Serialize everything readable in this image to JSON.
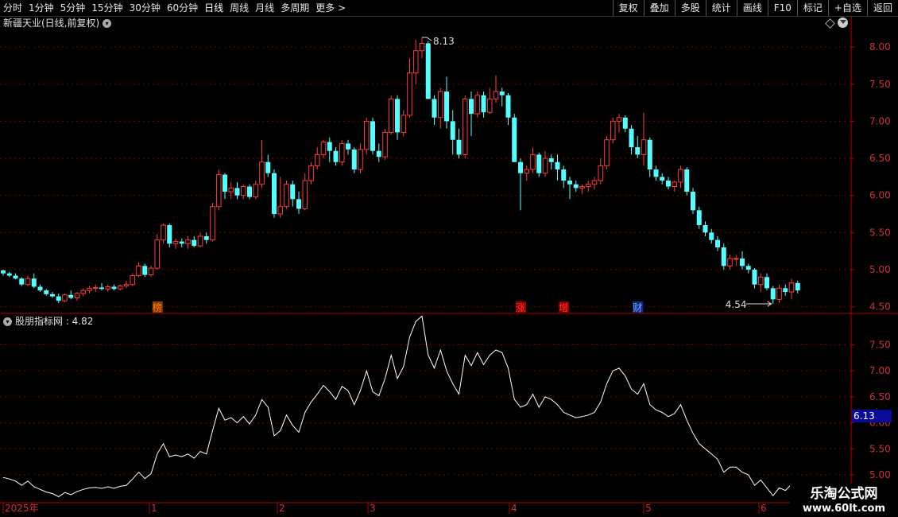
{
  "toolbar": {
    "periods": [
      "分时",
      "1分钟",
      "5分钟",
      "15分钟",
      "30分钟",
      "60分钟",
      "日线",
      "周线",
      "月线",
      "多周期",
      "更多 >"
    ],
    "active": "日线",
    "buttons": [
      "复权",
      "叠加",
      "多股",
      "统计",
      "画线",
      "F10",
      "标记",
      "+自选",
      "返回"
    ]
  },
  "title": "新疆天业(日线,前复权)",
  "indicator": {
    "name": "股朋指标网",
    "value": "4.82",
    "label": "股朋指标网 : 4.82"
  },
  "markers": [
    "榜",
    "涨",
    "增",
    "财"
  ],
  "annotations": {
    "high": "8.13",
    "low": "4.54"
  },
  "badge": "6.13",
  "xlabels": [
    "2025年",
    "1",
    "2",
    "3",
    "4",
    "5",
    "6"
  ],
  "watermark": {
    "top": "乐淘公式网",
    "bottom": "www.60lt.com"
  },
  "colors": {
    "up": "#ff3a3a",
    "down": "#54ffff",
    "grid": "#7a0000",
    "axis": "#b40000",
    "line": "#ffffff"
  },
  "chart_data": [
    {
      "type": "candlestick",
      "title": "新疆天业(日线,前复权)",
      "ylim": [
        4.4,
        8.25
      ],
      "yticks": [
        4.5,
        5.0,
        5.5,
        6.0,
        6.5,
        7.0,
        7.5,
        8.0
      ],
      "candles": [
        [
          4.99,
          5.0,
          4.92,
          4.95
        ],
        [
          4.95,
          4.97,
          4.9,
          4.92
        ],
        [
          4.92,
          4.95,
          4.87,
          4.88
        ],
        [
          4.88,
          4.9,
          4.78,
          4.8
        ],
        [
          4.8,
          4.92,
          4.78,
          4.88
        ],
        [
          4.88,
          4.95,
          4.75,
          4.77
        ],
        [
          4.77,
          4.8,
          4.7,
          4.72
        ],
        [
          4.72,
          4.74,
          4.65,
          4.67
        ],
        [
          4.67,
          4.7,
          4.62,
          4.64
        ],
        [
          4.64,
          4.68,
          4.55,
          4.58
        ],
        [
          4.58,
          4.68,
          4.56,
          4.66
        ],
        [
          4.66,
          4.72,
          4.6,
          4.62
        ],
        [
          4.62,
          4.7,
          4.58,
          4.68
        ],
        [
          4.68,
          4.75,
          4.64,
          4.72
        ],
        [
          4.72,
          4.78,
          4.68,
          4.75
        ],
        [
          4.75,
          4.8,
          4.7,
          4.76
        ],
        [
          4.76,
          4.82,
          4.72,
          4.74
        ],
        [
          4.74,
          4.8,
          4.7,
          4.77
        ],
        [
          4.77,
          4.8,
          4.72,
          4.74
        ],
        [
          4.74,
          4.8,
          4.72,
          4.78
        ],
        [
          4.78,
          4.85,
          4.75,
          4.8
        ],
        [
          4.8,
          4.95,
          4.78,
          4.92
        ],
        [
          4.92,
          5.1,
          4.9,
          5.05
        ],
        [
          5.05,
          5.08,
          4.9,
          4.93
        ],
        [
          4.93,
          5.05,
          4.9,
          5.02
        ],
        [
          5.02,
          5.48,
          5.0,
          5.4
        ],
        [
          5.4,
          5.62,
          5.35,
          5.6
        ],
        [
          5.6,
          5.62,
          5.3,
          5.35
        ],
        [
          5.35,
          5.42,
          5.28,
          5.38
        ],
        [
          5.38,
          5.42,
          5.3,
          5.35
        ],
        [
          5.35,
          5.45,
          5.28,
          5.4
        ],
        [
          5.4,
          5.45,
          5.3,
          5.32
        ],
        [
          5.32,
          5.5,
          5.3,
          5.45
        ],
        [
          5.45,
          5.5,
          5.35,
          5.4
        ],
        [
          5.4,
          5.9,
          5.38,
          5.85
        ],
        [
          5.85,
          6.35,
          5.8,
          6.28
        ],
        [
          6.28,
          6.3,
          5.95,
          6.05
        ],
        [
          6.05,
          6.18,
          5.95,
          6.1
        ],
        [
          6.1,
          6.18,
          5.95,
          6.0
        ],
        [
          6.0,
          6.15,
          5.95,
          6.12
        ],
        [
          6.12,
          6.15,
          5.95,
          5.98
        ],
        [
          5.98,
          6.2,
          5.95,
          6.15
        ],
        [
          6.15,
          6.75,
          6.1,
          6.45
        ],
        [
          6.45,
          6.55,
          6.25,
          6.3
        ],
        [
          6.3,
          6.35,
          5.7,
          5.75
        ],
        [
          5.75,
          6.25,
          5.7,
          5.85
        ],
        [
          5.85,
          6.2,
          5.82,
          6.15
        ],
        [
          6.15,
          6.2,
          5.85,
          5.95
        ],
        [
          5.95,
          6.05,
          5.75,
          5.82
        ],
        [
          5.82,
          6.3,
          5.8,
          6.2
        ],
        [
          6.2,
          6.45,
          6.15,
          6.4
        ],
        [
          6.4,
          6.65,
          6.35,
          6.55
        ],
        [
          6.55,
          6.75,
          6.5,
          6.72
        ],
        [
          6.72,
          6.78,
          6.45,
          6.6
        ],
        [
          6.6,
          6.65,
          6.4,
          6.45
        ],
        [
          6.45,
          6.75,
          6.4,
          6.7
        ],
        [
          6.7,
          6.75,
          6.55,
          6.62
        ],
        [
          6.62,
          6.65,
          6.3,
          6.35
        ],
        [
          6.35,
          6.7,
          6.3,
          6.62
        ],
        [
          6.62,
          7.05,
          6.55,
          7.0
        ],
        [
          7.0,
          7.05,
          6.55,
          6.6
        ],
        [
          6.6,
          6.7,
          6.45,
          6.52
        ],
        [
          6.52,
          6.9,
          6.48,
          6.85
        ],
        [
          6.85,
          7.35,
          6.82,
          7.3
        ],
        [
          7.3,
          7.35,
          6.75,
          6.85
        ],
        [
          6.85,
          7.15,
          6.8,
          7.08
        ],
        [
          7.08,
          7.85,
          7.05,
          7.65
        ],
        [
          7.65,
          8.1,
          7.5,
          7.95
        ],
        [
          7.95,
          8.13,
          7.85,
          8.05
        ],
        [
          8.05,
          8.08,
          7.3,
          7.3
        ],
        [
          7.3,
          7.35,
          6.95,
          7.05
        ],
        [
          7.05,
          7.45,
          6.9,
          7.4
        ],
        [
          7.4,
          7.6,
          6.9,
          7.0
        ],
        [
          7.0,
          7.15,
          6.55,
          6.75
        ],
        [
          6.75,
          6.9,
          6.5,
          6.55
        ],
        [
          6.55,
          7.35,
          6.5,
          7.3
        ],
        [
          7.3,
          7.4,
          6.8,
          7.1
        ],
        [
          7.1,
          7.4,
          7.05,
          7.35
        ],
        [
          7.35,
          7.4,
          7.05,
          7.12
        ],
        [
          7.12,
          7.45,
          7.1,
          7.3
        ],
        [
          7.3,
          7.62,
          7.25,
          7.4
        ],
        [
          7.4,
          7.45,
          7.2,
          7.35
        ],
        [
          7.35,
          7.38,
          6.95,
          7.05
        ],
        [
          7.05,
          7.1,
          6.45,
          6.45
        ],
        [
          6.45,
          6.5,
          5.8,
          6.3
        ],
        [
          6.3,
          6.4,
          6.2,
          6.35
        ],
        [
          6.35,
          6.65,
          6.3,
          6.55
        ],
        [
          6.55,
          6.58,
          6.25,
          6.3
        ],
        [
          6.3,
          6.6,
          6.25,
          6.5
        ],
        [
          6.5,
          6.55,
          6.35,
          6.45
        ],
        [
          6.45,
          6.55,
          6.2,
          6.35
        ],
        [
          6.35,
          6.4,
          6.1,
          6.2
        ],
        [
          6.2,
          6.25,
          5.95,
          6.15
        ],
        [
          6.15,
          6.2,
          6.05,
          6.1
        ],
        [
          6.1,
          6.15,
          6.02,
          6.12
        ],
        [
          6.12,
          6.2,
          6.05,
          6.15
        ],
        [
          6.15,
          6.25,
          6.08,
          6.2
        ],
        [
          6.2,
          6.5,
          6.15,
          6.4
        ],
        [
          6.4,
          6.8,
          6.35,
          6.75
        ],
        [
          6.75,
          7.05,
          6.7,
          7.0
        ],
        [
          7.0,
          7.1,
          6.85,
          7.05
        ],
        [
          7.05,
          7.08,
          6.85,
          6.9
        ],
        [
          6.9,
          6.95,
          6.55,
          6.65
        ],
        [
          6.65,
          6.8,
          6.5,
          6.55
        ],
        [
          6.55,
          7.12,
          6.4,
          6.75
        ],
        [
          6.75,
          6.78,
          6.25,
          6.35
        ],
        [
          6.35,
          6.4,
          6.2,
          6.25
        ],
        [
          6.25,
          6.3,
          6.15,
          6.2
        ],
        [
          6.2,
          6.25,
          6.08,
          6.12
        ],
        [
          6.12,
          6.2,
          6.05,
          6.18
        ],
        [
          6.18,
          6.4,
          6.1,
          6.35
        ],
        [
          6.35,
          6.38,
          6.0,
          6.05
        ],
        [
          6.05,
          6.1,
          5.75,
          5.8
        ],
        [
          5.8,
          5.85,
          5.55,
          5.6
        ],
        [
          5.6,
          5.65,
          5.45,
          5.5
        ],
        [
          5.5,
          5.55,
          5.35,
          5.4
        ],
        [
          5.4,
          5.45,
          5.25,
          5.3
        ],
        [
          5.3,
          5.35,
          5.0,
          5.05
        ],
        [
          5.05,
          5.2,
          5.0,
          5.15
        ],
        [
          5.15,
          5.2,
          5.05,
          5.15
        ],
        [
          5.15,
          5.25,
          5.0,
          5.05
        ],
        [
          5.05,
          5.08,
          4.95,
          5.0
        ],
        [
          5.0,
          5.02,
          4.75,
          4.8
        ],
        [
          4.8,
          4.95,
          4.7,
          4.9
        ],
        [
          4.9,
          4.95,
          4.72,
          4.75
        ],
        [
          4.75,
          4.78,
          4.54,
          4.6
        ],
        [
          4.6,
          4.8,
          4.55,
          4.75
        ],
        [
          4.75,
          4.8,
          4.65,
          4.7
        ],
        [
          4.7,
          4.88,
          4.6,
          4.82
        ],
        [
          4.82,
          4.85,
          4.68,
          4.72
        ]
      ]
    },
    {
      "type": "line",
      "series": [
        {
          "name": "股朋指标网",
          "values": [
            4.95,
            4.92,
            4.88,
            4.8,
            4.88,
            4.77,
            4.72,
            4.67,
            4.64,
            4.58,
            4.66,
            4.62,
            4.68,
            4.72,
            4.75,
            4.76,
            4.74,
            4.77,
            4.74,
            4.78,
            4.8,
            4.92,
            5.05,
            4.93,
            5.02,
            5.4,
            5.6,
            5.35,
            5.38,
            5.35,
            5.4,
            5.32,
            5.45,
            5.4,
            5.85,
            6.28,
            6.05,
            6.1,
            6.0,
            6.12,
            5.98,
            6.15,
            6.45,
            6.3,
            5.75,
            5.85,
            6.15,
            5.95,
            5.82,
            6.2,
            6.4,
            6.55,
            6.72,
            6.6,
            6.45,
            6.7,
            6.62,
            6.35,
            6.62,
            7.0,
            6.6,
            6.52,
            6.85,
            7.3,
            6.85,
            7.08,
            7.65,
            7.95,
            8.05,
            7.3,
            7.05,
            7.4,
            7.0,
            6.75,
            6.55,
            7.3,
            7.1,
            7.35,
            7.12,
            7.3,
            7.4,
            7.35,
            7.05,
            6.45,
            6.3,
            6.35,
            6.55,
            6.3,
            6.5,
            6.45,
            6.35,
            6.2,
            6.15,
            6.1,
            6.12,
            6.15,
            6.2,
            6.4,
            6.75,
            7.0,
            7.05,
            6.9,
            6.65,
            6.55,
            6.75,
            6.35,
            6.25,
            6.2,
            6.12,
            6.18,
            6.35,
            6.05,
            5.8,
            5.6,
            5.5,
            5.4,
            5.3,
            5.05,
            5.15,
            5.15,
            5.05,
            5.0,
            4.8,
            4.9,
            4.75,
            4.6,
            4.75,
            4.7,
            4.82,
            4.72
          ]
        }
      ],
      "ylim": [
        4.95,
        7.95
      ],
      "yticks": [
        5.0,
        5.5,
        6.0,
        6.5,
        7.0,
        7.5
      ]
    }
  ]
}
